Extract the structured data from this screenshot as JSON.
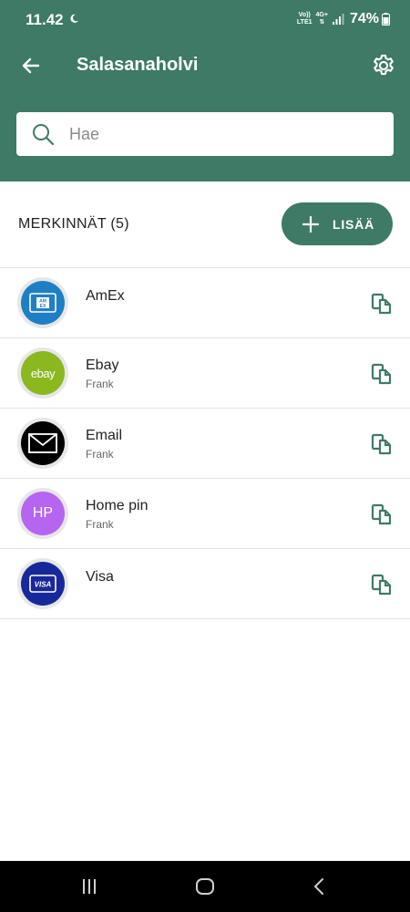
{
  "status_bar": {
    "time": "11.42",
    "network_top": "Vo))",
    "network_bottom": "LTE1",
    "network_gen": "4G+",
    "battery": "74%"
  },
  "header": {
    "title": "Salasanaholvi",
    "back_icon": "arrow-left-icon",
    "settings_icon": "gear-icon"
  },
  "search": {
    "placeholder": "Hae",
    "value": ""
  },
  "entries": {
    "count_label": "MERKINNÄT (5)",
    "add_label": "LISÄÄ"
  },
  "items": [
    {
      "title": "AmEx",
      "subtitle": "",
      "avatar_type": "amex",
      "avatar_text": "AM EX",
      "avatar_color": "#1f7fc4"
    },
    {
      "title": "Ebay",
      "subtitle": "Frank",
      "avatar_type": "ebay",
      "avatar_text": "ebay",
      "avatar_color": "#8ab81e"
    },
    {
      "title": "Email",
      "subtitle": "Frank",
      "avatar_type": "email",
      "avatar_text": "",
      "avatar_color": "#000000"
    },
    {
      "title": "Home pin",
      "subtitle": "Frank",
      "avatar_type": "initials",
      "avatar_text": "HP",
      "avatar_color": "#b565f0"
    },
    {
      "title": "Visa",
      "subtitle": "",
      "avatar_type": "visa",
      "avatar_text": "VISA",
      "avatar_color": "#17299a"
    }
  ],
  "colors": {
    "primary": "#3e7a66",
    "divider": "#e2e2e2"
  },
  "nav": {
    "recent_icon": "recent-apps-icon",
    "home_icon": "home-icon",
    "back_icon": "back-chevron-icon"
  }
}
